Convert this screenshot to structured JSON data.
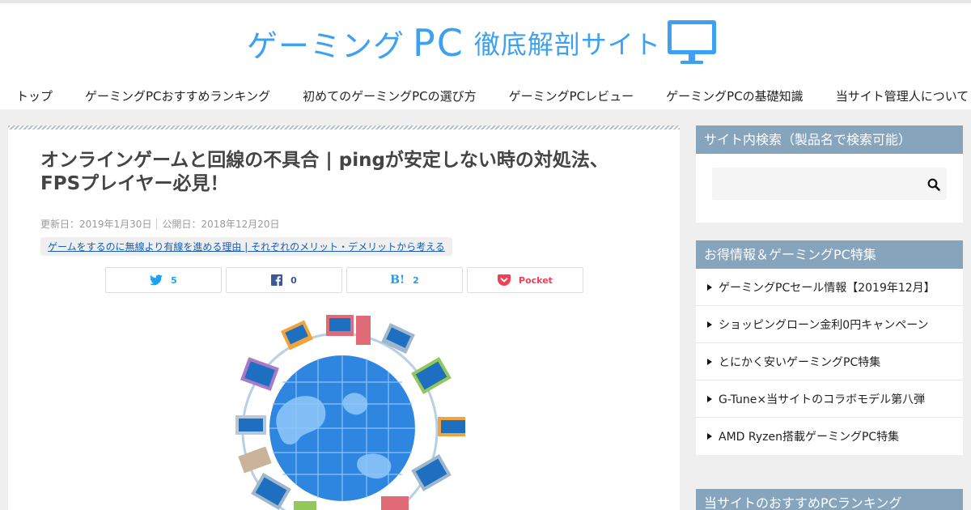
{
  "logo": {
    "part1": "ゲーミング",
    "part2": "PC",
    "part3": "徹底解剖サイト",
    "icon": "monitor-icon",
    "color": "#3ea0f2"
  },
  "nav": [
    {
      "label": "トップ"
    },
    {
      "label": "ゲーミングPCおすすめランキング"
    },
    {
      "label": "初めてのゲーミングPCの選び方"
    },
    {
      "label": "ゲーミングPCレビュー"
    },
    {
      "label": "ゲーミングPCの基礎知識"
    },
    {
      "label": "当サイト管理人について"
    }
  ],
  "article": {
    "title_line1": "オンラインゲームと回線の不具合 | pingが安定しない時の対処法、",
    "title_line2": "FPSプレイヤー必見！",
    "updated": "更新日：2019年1月30日",
    "published": "公開日：2018年12月20日",
    "tag": "ゲームをするのに無線より有線を進める理由 | それぞれのメリット・デメリットから考える"
  },
  "share": {
    "twitter": {
      "icon": "twitter-icon",
      "count": "5"
    },
    "facebook": {
      "icon": "facebook-icon",
      "count": "0"
    },
    "hatena": {
      "icon": "hatena-bookmark-icon",
      "label": "B!",
      "count": "2"
    },
    "pocket": {
      "icon": "pocket-icon",
      "label": "Pocket"
    }
  },
  "sidebar": {
    "search_title": "サイト内検索（製品名で検索可能）",
    "search_icon": "search-icon",
    "deals_title": "お得情報＆ゲーミングPC特集",
    "deals": [
      {
        "label": "ゲーミングPCセール情報【2019年12月】"
      },
      {
        "label": "ショッピングローン金利0円キャンペーン"
      },
      {
        "label": "とにかく安いゲーミングPC特集"
      },
      {
        "label": "G-Tune×当サイトのコラボモデル第八弾"
      },
      {
        "label": "AMD Ryzen搭載ゲーミングPC特集"
      }
    ],
    "ranking_title": "当サイトのおすすめPCランキング"
  },
  "colors": {
    "accent": "#3ea0f2",
    "widget_header": "#87a4bd",
    "tag_link": "#1a5fb4"
  }
}
